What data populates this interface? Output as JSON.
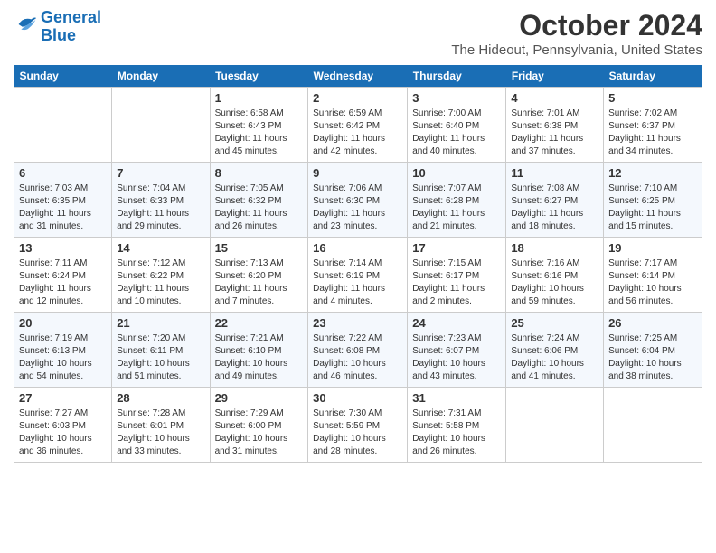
{
  "logo": {
    "line1": "General",
    "line2": "Blue"
  },
  "title": "October 2024",
  "location": "The Hideout, Pennsylvania, United States",
  "weekdays": [
    "Sunday",
    "Monday",
    "Tuesday",
    "Wednesday",
    "Thursday",
    "Friday",
    "Saturday"
  ],
  "weeks": [
    [
      null,
      null,
      {
        "day": "1",
        "sunrise": "Sunrise: 6:58 AM",
        "sunset": "Sunset: 6:43 PM",
        "daylight": "Daylight: 11 hours and 45 minutes."
      },
      {
        "day": "2",
        "sunrise": "Sunrise: 6:59 AM",
        "sunset": "Sunset: 6:42 PM",
        "daylight": "Daylight: 11 hours and 42 minutes."
      },
      {
        "day": "3",
        "sunrise": "Sunrise: 7:00 AM",
        "sunset": "Sunset: 6:40 PM",
        "daylight": "Daylight: 11 hours and 40 minutes."
      },
      {
        "day": "4",
        "sunrise": "Sunrise: 7:01 AM",
        "sunset": "Sunset: 6:38 PM",
        "daylight": "Daylight: 11 hours and 37 minutes."
      },
      {
        "day": "5",
        "sunrise": "Sunrise: 7:02 AM",
        "sunset": "Sunset: 6:37 PM",
        "daylight": "Daylight: 11 hours and 34 minutes."
      }
    ],
    [
      {
        "day": "6",
        "sunrise": "Sunrise: 7:03 AM",
        "sunset": "Sunset: 6:35 PM",
        "daylight": "Daylight: 11 hours and 31 minutes."
      },
      {
        "day": "7",
        "sunrise": "Sunrise: 7:04 AM",
        "sunset": "Sunset: 6:33 PM",
        "daylight": "Daylight: 11 hours and 29 minutes."
      },
      {
        "day": "8",
        "sunrise": "Sunrise: 7:05 AM",
        "sunset": "Sunset: 6:32 PM",
        "daylight": "Daylight: 11 hours and 26 minutes."
      },
      {
        "day": "9",
        "sunrise": "Sunrise: 7:06 AM",
        "sunset": "Sunset: 6:30 PM",
        "daylight": "Daylight: 11 hours and 23 minutes."
      },
      {
        "day": "10",
        "sunrise": "Sunrise: 7:07 AM",
        "sunset": "Sunset: 6:28 PM",
        "daylight": "Daylight: 11 hours and 21 minutes."
      },
      {
        "day": "11",
        "sunrise": "Sunrise: 7:08 AM",
        "sunset": "Sunset: 6:27 PM",
        "daylight": "Daylight: 11 hours and 18 minutes."
      },
      {
        "day": "12",
        "sunrise": "Sunrise: 7:10 AM",
        "sunset": "Sunset: 6:25 PM",
        "daylight": "Daylight: 11 hours and 15 minutes."
      }
    ],
    [
      {
        "day": "13",
        "sunrise": "Sunrise: 7:11 AM",
        "sunset": "Sunset: 6:24 PM",
        "daylight": "Daylight: 11 hours and 12 minutes."
      },
      {
        "day": "14",
        "sunrise": "Sunrise: 7:12 AM",
        "sunset": "Sunset: 6:22 PM",
        "daylight": "Daylight: 11 hours and 10 minutes."
      },
      {
        "day": "15",
        "sunrise": "Sunrise: 7:13 AM",
        "sunset": "Sunset: 6:20 PM",
        "daylight": "Daylight: 11 hours and 7 minutes."
      },
      {
        "day": "16",
        "sunrise": "Sunrise: 7:14 AM",
        "sunset": "Sunset: 6:19 PM",
        "daylight": "Daylight: 11 hours and 4 minutes."
      },
      {
        "day": "17",
        "sunrise": "Sunrise: 7:15 AM",
        "sunset": "Sunset: 6:17 PM",
        "daylight": "Daylight: 11 hours and 2 minutes."
      },
      {
        "day": "18",
        "sunrise": "Sunrise: 7:16 AM",
        "sunset": "Sunset: 6:16 PM",
        "daylight": "Daylight: 10 hours and 59 minutes."
      },
      {
        "day": "19",
        "sunrise": "Sunrise: 7:17 AM",
        "sunset": "Sunset: 6:14 PM",
        "daylight": "Daylight: 10 hours and 56 minutes."
      }
    ],
    [
      {
        "day": "20",
        "sunrise": "Sunrise: 7:19 AM",
        "sunset": "Sunset: 6:13 PM",
        "daylight": "Daylight: 10 hours and 54 minutes."
      },
      {
        "day": "21",
        "sunrise": "Sunrise: 7:20 AM",
        "sunset": "Sunset: 6:11 PM",
        "daylight": "Daylight: 10 hours and 51 minutes."
      },
      {
        "day": "22",
        "sunrise": "Sunrise: 7:21 AM",
        "sunset": "Sunset: 6:10 PM",
        "daylight": "Daylight: 10 hours and 49 minutes."
      },
      {
        "day": "23",
        "sunrise": "Sunrise: 7:22 AM",
        "sunset": "Sunset: 6:08 PM",
        "daylight": "Daylight: 10 hours and 46 minutes."
      },
      {
        "day": "24",
        "sunrise": "Sunrise: 7:23 AM",
        "sunset": "Sunset: 6:07 PM",
        "daylight": "Daylight: 10 hours and 43 minutes."
      },
      {
        "day": "25",
        "sunrise": "Sunrise: 7:24 AM",
        "sunset": "Sunset: 6:06 PM",
        "daylight": "Daylight: 10 hours and 41 minutes."
      },
      {
        "day": "26",
        "sunrise": "Sunrise: 7:25 AM",
        "sunset": "Sunset: 6:04 PM",
        "daylight": "Daylight: 10 hours and 38 minutes."
      }
    ],
    [
      {
        "day": "27",
        "sunrise": "Sunrise: 7:27 AM",
        "sunset": "Sunset: 6:03 PM",
        "daylight": "Daylight: 10 hours and 36 minutes."
      },
      {
        "day": "28",
        "sunrise": "Sunrise: 7:28 AM",
        "sunset": "Sunset: 6:01 PM",
        "daylight": "Daylight: 10 hours and 33 minutes."
      },
      {
        "day": "29",
        "sunrise": "Sunrise: 7:29 AM",
        "sunset": "Sunset: 6:00 PM",
        "daylight": "Daylight: 10 hours and 31 minutes."
      },
      {
        "day": "30",
        "sunrise": "Sunrise: 7:30 AM",
        "sunset": "Sunset: 5:59 PM",
        "daylight": "Daylight: 10 hours and 28 minutes."
      },
      {
        "day": "31",
        "sunrise": "Sunrise: 7:31 AM",
        "sunset": "Sunset: 5:58 PM",
        "daylight": "Daylight: 10 hours and 26 minutes."
      },
      null,
      null
    ]
  ]
}
